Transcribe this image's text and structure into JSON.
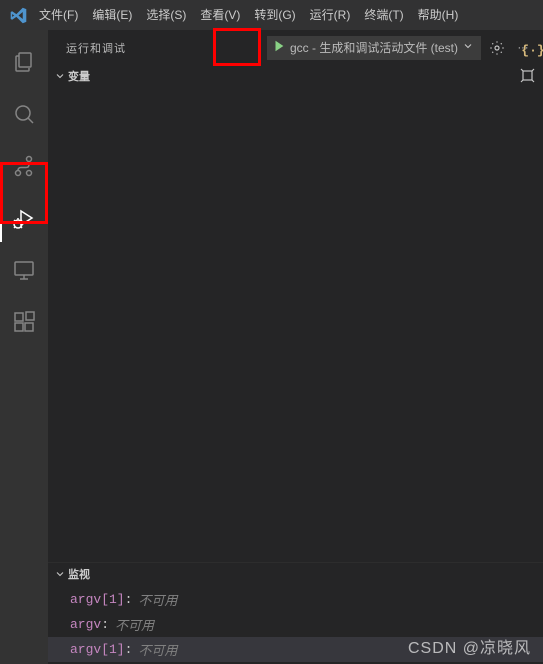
{
  "menu": {
    "file": "文件(F)",
    "edit": "编辑(E)",
    "select": "选择(S)",
    "view": "查看(V)",
    "goto": "转到(G)",
    "run": "运行(R)",
    "terminal": "终端(T)",
    "help": "帮助(H)"
  },
  "sidebar": {
    "title": "运行和调试",
    "config_label": "gcc - 生成和调试活动文件 (test)",
    "more_symbol": "···"
  },
  "sections": {
    "variables": "变量",
    "watch": "监视"
  },
  "watch": [
    {
      "name": "argv[1]",
      "value": "不可用"
    },
    {
      "name": "argv",
      "value": "不可用"
    },
    {
      "name": "argv[1]",
      "value": "不可用"
    }
  ],
  "bracket": "{·}",
  "watermark": "CSDN @凉晓风"
}
